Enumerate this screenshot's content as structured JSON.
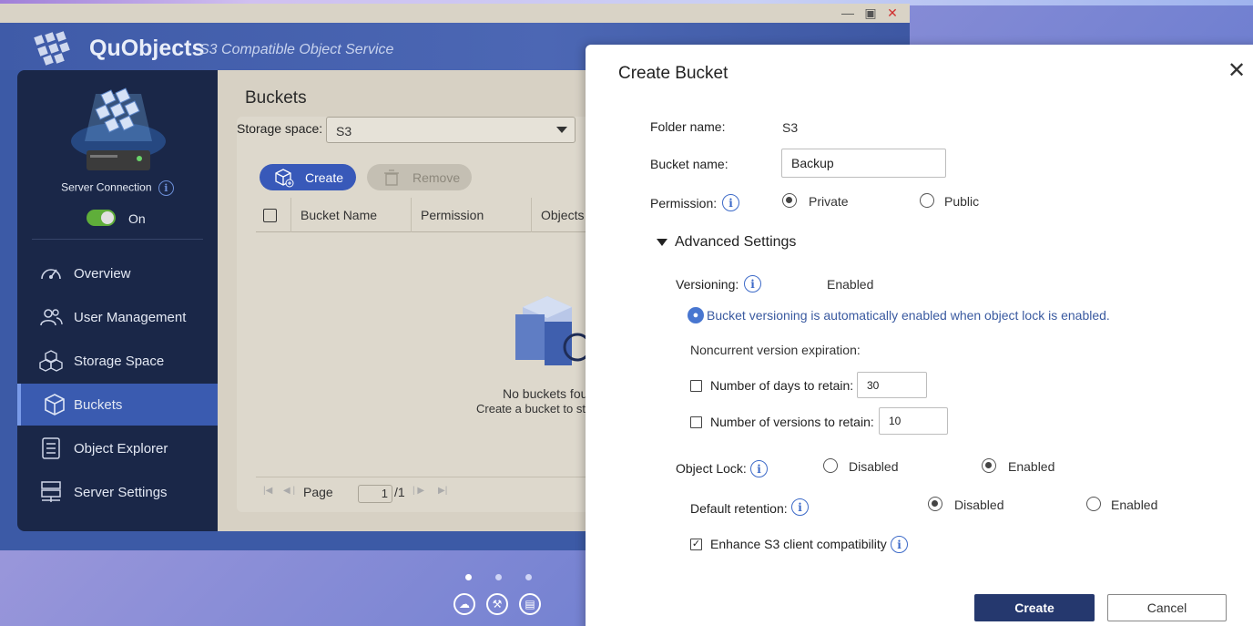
{
  "app": {
    "name": "QuObjects",
    "subtitle": "S3 Compatible Object Service"
  },
  "sidebar": {
    "server_connection_label": "Server Connection",
    "connection_state": "On",
    "items": [
      {
        "label": "Overview",
        "icon": "gauge-icon",
        "active": false
      },
      {
        "label": "User Management",
        "icon": "users-icon",
        "active": false
      },
      {
        "label": "Storage Space",
        "icon": "cubes-icon",
        "active": false
      },
      {
        "label": "Buckets",
        "icon": "cube-icon",
        "active": true
      },
      {
        "label": "Object Explorer",
        "icon": "list-icon",
        "active": false
      },
      {
        "label": "Server Settings",
        "icon": "settings-list-icon",
        "active": false
      }
    ]
  },
  "buckets_page": {
    "title": "Buckets",
    "storage_space_label": "Storage space:",
    "storage_space_value": "S3",
    "create_label": "Create",
    "remove_label": "Remove",
    "columns": [
      "Bucket Name",
      "Permission",
      "Objects"
    ],
    "empty_title": "No buckets fou",
    "empty_subtitle": "Create a bucket to start",
    "pager": {
      "page_label": "Page",
      "current": "1",
      "total": "/1"
    }
  },
  "dialog": {
    "title": "Create Bucket",
    "folder_name_label": "Folder name:",
    "folder_name_value": "S3",
    "bucket_name_label": "Bucket name:",
    "bucket_name_value": "Backup",
    "permission_label": "Permission:",
    "permission_options": [
      "Private",
      "Public"
    ],
    "permission_selected": "Private",
    "advanced_label": "Advanced Settings",
    "versioning_label": "Versioning:",
    "versioning_value": "Enabled",
    "versioning_hint": "Bucket versioning is automatically enabled when object lock is enabled.",
    "noncurrent_label": "Noncurrent version expiration:",
    "days_label": "Number of days to retain:",
    "days_value": "30",
    "days_checked": false,
    "versions_label": "Number of versions to retain:",
    "versions_value": "10",
    "versions_checked": false,
    "object_lock_label": "Object Lock:",
    "object_lock_options": [
      "Disabled",
      "Enabled"
    ],
    "object_lock_selected": "Enabled",
    "default_retention_label": "Default retention:",
    "default_retention_options": [
      "Disabled",
      "Enabled"
    ],
    "default_retention_selected": "Disabled",
    "enhance_label": "Enhance S3 client compatibility",
    "enhance_checked": true,
    "create_button": "Create",
    "cancel_button": "Cancel"
  },
  "colors": {
    "accent": "#3859b9",
    "sidebar_bg": "#1a2748",
    "primary_button": "#25386e",
    "toggle_on": "#5fae3a"
  }
}
